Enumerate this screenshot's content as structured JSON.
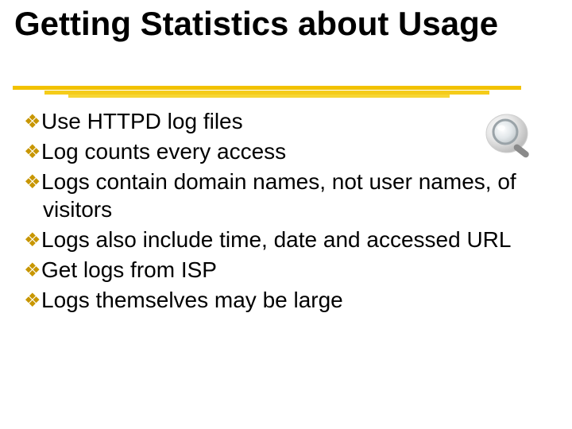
{
  "title": "Getting Statistics about Usage",
  "bullets": [
    "Use HTTPD log files",
    "Log counts every access",
    "Logs contain domain names, not user names, of visitors",
    "Logs also include time, date and accessed URL",
    "Get logs from ISP",
    "Logs themselves may be large"
  ],
  "icon": "magnifying-glass"
}
